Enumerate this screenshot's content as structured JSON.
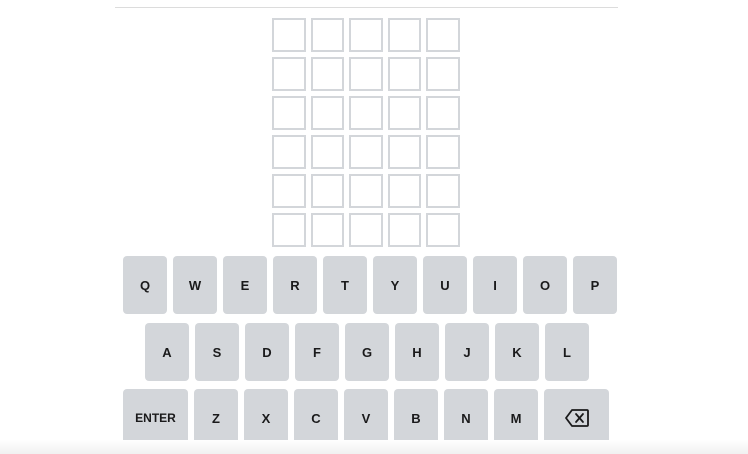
{
  "board": {
    "rows": [
      [
        "",
        "",
        "",
        "",
        ""
      ],
      [
        "",
        "",
        "",
        "",
        ""
      ],
      [
        "",
        "",
        "",
        "",
        ""
      ],
      [
        "",
        "",
        "",
        "",
        ""
      ],
      [
        "",
        "",
        "",
        "",
        ""
      ],
      [
        "",
        "",
        "",
        "",
        ""
      ]
    ]
  },
  "keyboard": {
    "row1": [
      "Q",
      "W",
      "E",
      "R",
      "T",
      "Y",
      "U",
      "I",
      "O",
      "P"
    ],
    "row2": [
      "A",
      "S",
      "D",
      "F",
      "G",
      "H",
      "J",
      "K",
      "L"
    ],
    "row3": {
      "enter_label": "ENTER",
      "letters": [
        "Z",
        "X",
        "C",
        "V",
        "B",
        "N",
        "M"
      ],
      "backspace_icon": "backspace-icon"
    }
  },
  "colors": {
    "tile_border": "#d3d6da",
    "key_bg": "#d3d6da",
    "key_text": "#1a1a1b"
  }
}
